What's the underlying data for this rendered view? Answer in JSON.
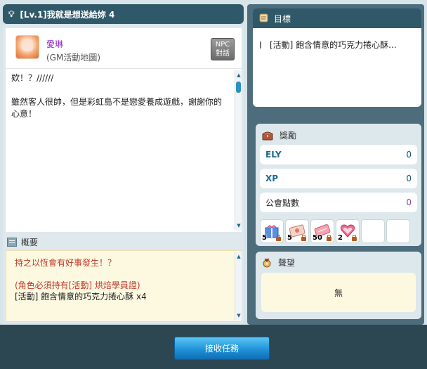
{
  "quest": {
    "title": "[Lv.1]我就是想送給妳 4"
  },
  "npc": {
    "name": "愛琳",
    "map": "(GM活動地圖)",
    "talk_button": "NPC\n對話"
  },
  "dialog": {
    "lines": [
      "欸！？//////",
      "雖然客人很帥，但是彩虹島不是戀愛養成遊戲，謝謝你的心意！"
    ]
  },
  "summary": {
    "header": "概要",
    "line1": "持之以恆會有好事發生！？",
    "line2": "(角色必須持有[活動] 烘焙學員證)",
    "line3": "[活動] 飽含情意的巧克力捲心酥 x4"
  },
  "goal": {
    "header": "目標",
    "item": "[活動] 飽含情意的巧克力捲心酥..."
  },
  "reward": {
    "header": "獎勵",
    "rows": [
      {
        "label": "ELY",
        "value": "0"
      },
      {
        "label": "XP",
        "value": "0"
      },
      {
        "label": "公會點數",
        "value": "0"
      }
    ],
    "items": [
      {
        "icon": "gift-box-icon",
        "qty": "5",
        "color": "#3f7fd1"
      },
      {
        "icon": "card-icon",
        "qty": "5",
        "color": "#f4c6b8"
      },
      {
        "icon": "ticket-icon",
        "qty": "50",
        "color": "#f08a9a"
      },
      {
        "icon": "heart-cake-icon",
        "qty": "2",
        "color": "#e8426a"
      }
    ]
  },
  "reputation": {
    "header": "聲望",
    "value": "無"
  },
  "footer": {
    "accept_label": "接收任務"
  }
}
